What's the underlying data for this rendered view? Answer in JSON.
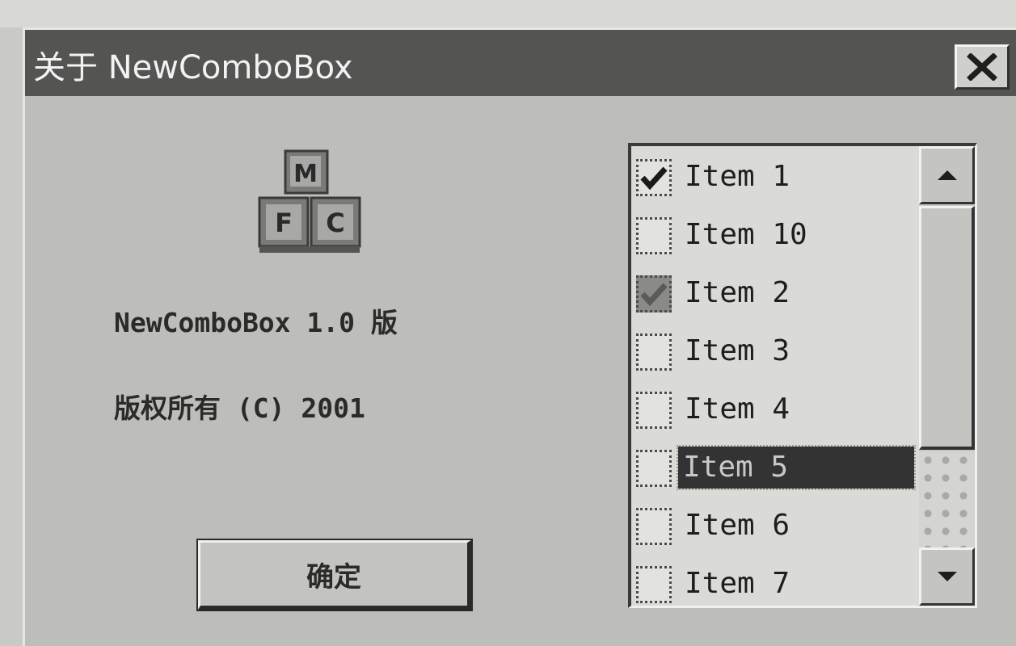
{
  "window": {
    "title": "关于 NewComboBox",
    "close_label": "X"
  },
  "icon": {
    "name": "mfc-blocks-icon",
    "letters": [
      "M",
      "F",
      "C"
    ]
  },
  "info": {
    "version": "NewComboBox 1.0 版",
    "copyright": "版权所有 (C) 2001"
  },
  "buttons": {
    "ok_label": "确定"
  },
  "list": {
    "items": [
      {
        "label": "Item 1",
        "checked": true,
        "selected": false
      },
      {
        "label": "Item 10",
        "checked": false,
        "selected": false
      },
      {
        "label": "Item 2",
        "checked": true,
        "selected": false
      },
      {
        "label": "Item 3",
        "checked": false,
        "selected": false
      },
      {
        "label": "Item 4",
        "checked": false,
        "selected": false
      },
      {
        "label": "Item 5",
        "checked": false,
        "selected": true
      },
      {
        "label": "Item 6",
        "checked": false,
        "selected": false
      },
      {
        "label": "Item 7",
        "checked": false,
        "selected": false
      }
    ]
  },
  "colors": {
    "titlebar": "#545453",
    "dialog_face": "#bdbdb9",
    "selection": "#333333"
  }
}
